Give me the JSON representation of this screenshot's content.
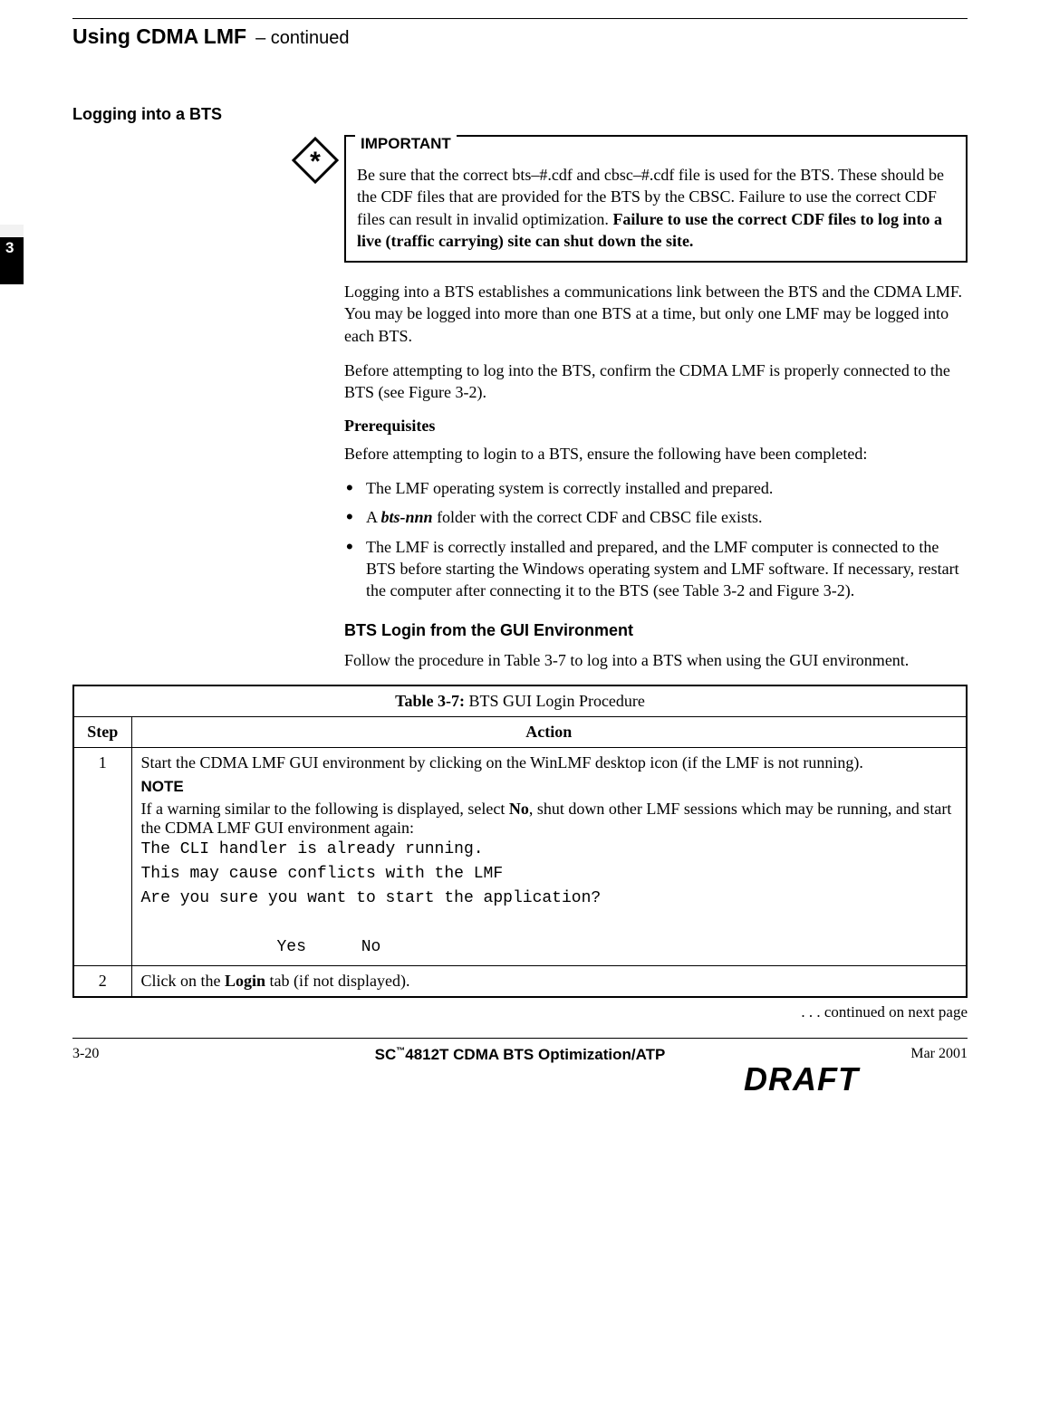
{
  "header": {
    "title": "Using CDMA LMF",
    "continued": "– continued"
  },
  "chapter_tab": "3",
  "section": {
    "title": "Logging into a BTS"
  },
  "important": {
    "label": "IMPORTANT",
    "text": "Be sure that the correct bts–#.cdf and cbsc–#.cdf file is used for the BTS. These should be the CDF files that are provided for the BTS by the CBSC. Failure to use the correct CDF files can result in invalid optimization. ",
    "bold_text": "Failure to use the correct CDF files to log into a live (traffic carrying) site can shut down the site."
  },
  "paras": {
    "p1": "Logging into a BTS establishes a communications link between the BTS and the CDMA LMF. You may be logged into more than one BTS at a time, but only one LMF may be logged into each BTS.",
    "p2": "Before attempting to log into the BTS, confirm the CDMA LMF is properly connected to the BTS (see Figure 3-2).",
    "prereq_heading": "Prerequisites",
    "prereq_intro": "Before attempting to login to a BTS, ensure the following have been completed:"
  },
  "bullets": {
    "b1": "The LMF operating system is correctly installed and prepared.",
    "b2_pre": "A ",
    "b2_bold": "bts-nnn",
    "b2_post": " folder with the correct CDF and CBSC file exists.",
    "b3": "The LMF is correctly installed and prepared, and the LMF computer is connected to the BTS before starting the Windows operating system and LMF software. If necessary, restart the computer after connecting it to the BTS (see Table 3-2 and Figure 3-2)."
  },
  "gui_section": {
    "heading": "BTS Login from the GUI Environment",
    "intro": "Follow the procedure in Table 3-7 to log into a BTS when using the GUI environment."
  },
  "table": {
    "caption_bold": "Table 3-7:",
    "caption_rest": " BTS GUI Login Procedure",
    "headers": {
      "step": "Step",
      "action": "Action"
    },
    "rows": [
      {
        "step": "1",
        "action_main": "Start the CDMA LMF GUI environment by clicking on the WinLMF desktop icon (if the LMF is not running).",
        "note_label": "NOTE",
        "note_pre": "If a warning similar to the following is displayed, select ",
        "note_bold": "No",
        "note_post": ", shut down other LMF sessions which may be running, and start the CDMA LMF GUI environment again:",
        "mono1": "The CLI handler is already running.",
        "mono2": "This may cause conflicts with the LMF",
        "mono3": "Are you sure you want to start the application?",
        "mono4": "Yes No"
      },
      {
        "step": "2",
        "action_pre": "Click on the ",
        "action_bold": "Login",
        "action_post": " tab (if not displayed)."
      }
    ],
    "continued": ". . . continued on next page"
  },
  "footer": {
    "page": "3-20",
    "center_pre": "SC",
    "center_tm": "™",
    "center_rest": "4812T CDMA BTS Optimization/ATP",
    "date": "Mar 2001",
    "draft": "DRAFT"
  }
}
